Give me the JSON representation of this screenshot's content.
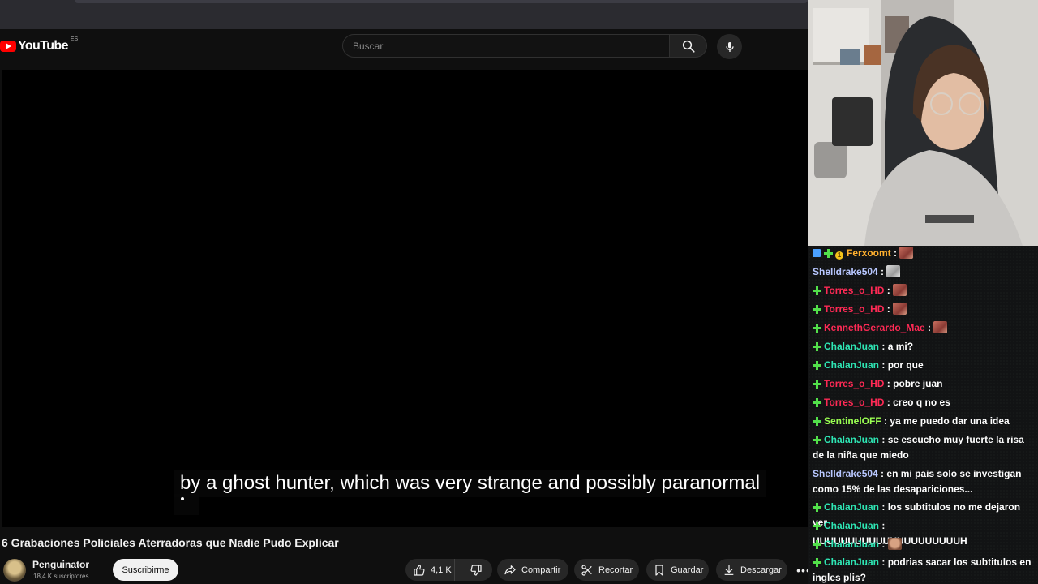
{
  "youtube": {
    "logo_text": "YouTube",
    "region": "ES",
    "search_placeholder": "Buscar",
    "caption_line": "by a ghost hunter, which was very strange and possibly paranormal",
    "video_title": "6 Grabaciones Policiales Aterradoras que Nadie Pudo Explicar",
    "channel_name": "Penguinator",
    "channel_subs": "18,4 K suscriptores",
    "subscribe_label": "Suscribirme",
    "likes": "4,1 K",
    "share_label": "Compartir",
    "clip_label": "Recortar",
    "save_label": "Guardar",
    "download_label": "Descargar",
    "more_label": "•••"
  },
  "chat": {
    "messages": [
      {
        "user": "Ferxoomt",
        "color": "#ffb02e",
        "text": "",
        "emote": "meat",
        "badges": [
          "blue",
          "plus",
          "coin"
        ]
      },
      {
        "user": "Shelldrake504",
        "color": "#b8c7ff",
        "text": "",
        "emote": "cat",
        "badges": []
      },
      {
        "user": "Torres_o_HD",
        "color": "#ff2a55",
        "text": "",
        "emote": "meat",
        "badges": [
          "plus"
        ]
      },
      {
        "user": "Torres_o_HD",
        "color": "#ff2a55",
        "text": "",
        "emote": "meat",
        "badges": [
          "plus"
        ]
      },
      {
        "user": "KennethGerardo_Mae",
        "color": "#ff2a55",
        "text": "",
        "emote": "meat",
        "badges": [
          "plus"
        ]
      },
      {
        "user": "ChalanJuan",
        "color": "#2ee6b4",
        "text": "a mi?",
        "badges": [
          "plus"
        ]
      },
      {
        "user": "ChalanJuan",
        "color": "#2ee6b4",
        "text": "por que",
        "badges": [
          "plus"
        ]
      },
      {
        "user": "Torres_o_HD",
        "color": "#ff2a55",
        "text": "pobre juan",
        "badges": [
          "plus"
        ]
      },
      {
        "user": "Torres_o_HD",
        "color": "#ff2a55",
        "text": "creo q no es",
        "badges": [
          "plus"
        ]
      },
      {
        "user": "SentinelOFF",
        "color": "#9aff52",
        "text": "ya me puedo dar una idea",
        "badges": [
          "plus"
        ]
      },
      {
        "user": "ChalanJuan",
        "color": "#2ee6b4",
        "text": "se escucho muy fuerte la risa de la niña que miedo",
        "badges": [
          "plus"
        ]
      },
      {
        "user": "Shelldrake504",
        "color": "#b8c7ff",
        "text": "en mi pais solo se investigan como 15% de las desapariciones...",
        "badges": []
      },
      {
        "user": "ChalanJuan",
        "color": "#2ee6b4",
        "text": "los subtitulos no me dejaron ver",
        "badges": [
          "plus"
        ]
      },
      {
        "user": "ChalanJuan",
        "color": "#2ee6b4",
        "text": "UUUUUUUUUUUUUUUUUUUUUH",
        "badges": [
          "plus"
        ]
      },
      {
        "user": "ChalanJuan",
        "color": "#2ee6b4",
        "text": "",
        "emote": "face",
        "badges": [
          "plus"
        ]
      },
      {
        "user": "ChalanJuan",
        "color": "#2ee6b4",
        "text": "podrias sacar los subtitulos en ingles plis?",
        "badges": [
          "plus"
        ]
      }
    ]
  }
}
